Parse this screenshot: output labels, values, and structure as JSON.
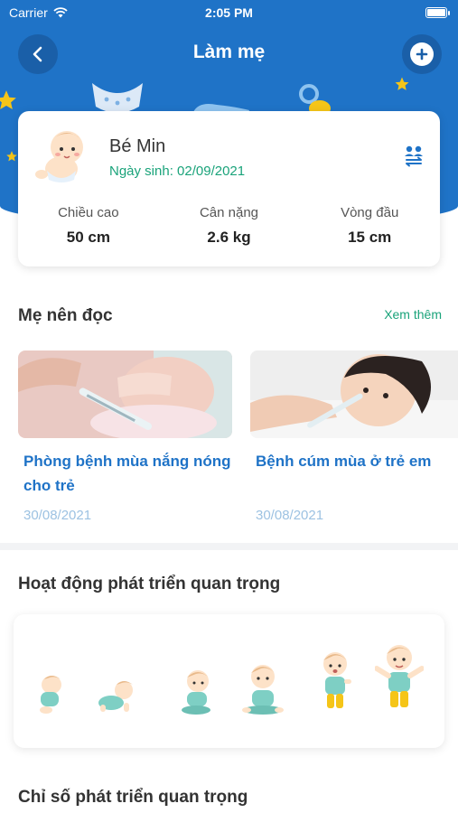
{
  "status_bar": {
    "carrier": "Carrier",
    "time": "2:05 PM"
  },
  "header": {
    "title": "Làm mẹ"
  },
  "profile": {
    "name": "Bé Min",
    "dob": "Ngày sinh: 02/09/2021",
    "metrics": [
      {
        "label": "Chiều cao",
        "value": "50 cm"
      },
      {
        "label": "Cân nặng",
        "value": "2.6 kg"
      },
      {
        "label": "Vòng đầu",
        "value": "15 cm"
      }
    ]
  },
  "reading": {
    "title": "Mẹ nên đọc",
    "see_more": "Xem thêm",
    "articles": [
      {
        "title": "Phòng bệnh mùa nắng nóng cho trẻ",
        "date": "30/08/2021"
      },
      {
        "title": "Bệnh cúm mùa ở trẻ em",
        "date": "30/08/2021"
      }
    ]
  },
  "activities": {
    "title": "Hoạt động phát triển quan trọng",
    "stages": [
      "lying-baby",
      "crawling-baby",
      "sitting-baby",
      "sitting-upright-baby",
      "standing-baby",
      "walking-baby"
    ]
  },
  "indicators": {
    "title": "Chỉ số phát triển quan trọng"
  },
  "colors": {
    "primary_blue": "#1f73c7",
    "accent_green": "#1aa37a",
    "date_blue": "#9dc2e2"
  }
}
